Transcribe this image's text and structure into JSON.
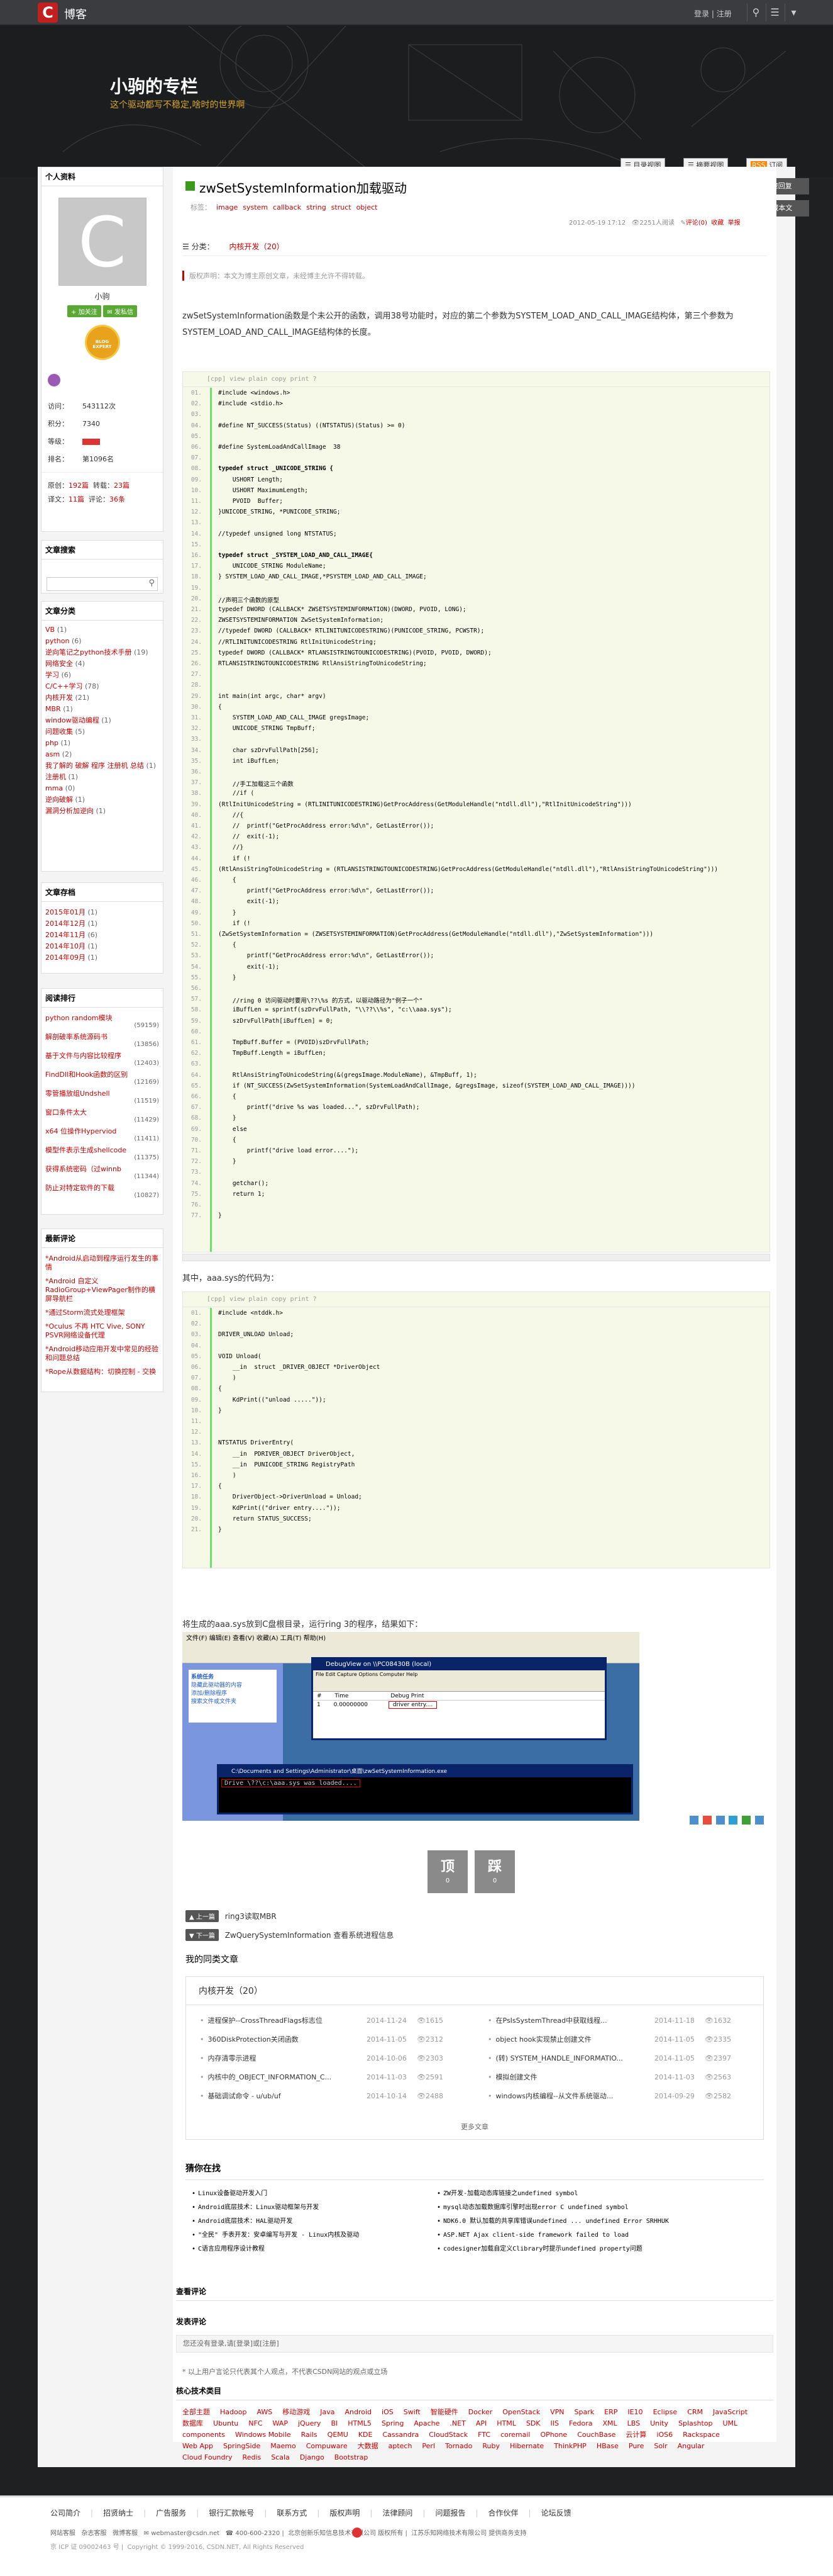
{
  "topbar": {
    "brand": "博客",
    "login": "登录",
    "sep": "|",
    "register": "注册"
  },
  "banner": {
    "title": "小驹的专栏",
    "subtitle": "这个驱动都写不稳定,啥时的世界啊",
    "btn_dir": "目录视图",
    "btn_summary": "摘要视图",
    "btn_rss": "订阅"
  },
  "right_tools": {
    "contact": "快速回复",
    "favorite": "收藏本文"
  },
  "profile": {
    "header": "个人资料",
    "name": "小驹",
    "follow": "+ 加关注",
    "message": "发私信",
    "visits_label": "访问：",
    "visits": "543112次",
    "points_label": "积分：",
    "points": "7340",
    "level_label": "等级：",
    "rank_label": "排名：",
    "rank": "第1096名",
    "orig_label": "原创：",
    "orig": "192篇",
    "repost_label": "转载：",
    "repost": "23篇",
    "trans_label": "译文：",
    "trans": "11篇",
    "comment_label": "评论：",
    "comment": "36条",
    "badge": "BLOG EXPERT"
  },
  "search": {
    "header": "文章搜索"
  },
  "categories": {
    "header": "文章分类",
    "items": [
      {
        "name": "VB",
        "count": "(1)"
      },
      {
        "name": "python",
        "count": "(6)"
      },
      {
        "name": "逆向笔记之python技术手册",
        "count": "(19)"
      },
      {
        "name": "网络安全",
        "count": "(4)"
      },
      {
        "name": "学习",
        "count": "(6)"
      },
      {
        "name": "C/C++学习",
        "count": "(78)"
      },
      {
        "name": "内核开发",
        "count": "(21)"
      },
      {
        "name": "MBR",
        "count": "(1)"
      },
      {
        "name": "window驱动编程",
        "count": "(1)"
      },
      {
        "name": "问题收集",
        "count": "(5)"
      },
      {
        "name": "php",
        "count": "(1)"
      },
      {
        "name": "asm",
        "count": "(2)"
      },
      {
        "name": "我了解的 破解 程序 注册机 总结",
        "count": "(1)"
      },
      {
        "name": "注册机",
        "count": "(1)"
      },
      {
        "name": "mma",
        "count": "(0)"
      },
      {
        "name": "逆向破解",
        "count": "(1)"
      },
      {
        "name": "漏洞分析加逆向",
        "count": "(1)"
      }
    ]
  },
  "archive": {
    "header": "文章存档",
    "items": [
      {
        "name": "2015年01月",
        "count": "(1)"
      },
      {
        "name": "2014年12月",
        "count": "(1)"
      },
      {
        "name": "2014年11月",
        "count": "(6)"
      },
      {
        "name": "2014年10月",
        "count": "(1)"
      },
      {
        "name": "2014年09月",
        "count": "(1)"
      }
    ]
  },
  "popular": {
    "header": "阅读排行",
    "items": [
      {
        "name": "python random模块",
        "count": "(59159)"
      },
      {
        "name": "解剖破率系统源码书",
        "count": "(13856)"
      },
      {
        "name": "基于文件与内容比较程序",
        "count": "(12403)"
      },
      {
        "name": "FindDll和Hook函数的区别",
        "count": "(12169)"
      },
      {
        "name": "零管播放组Undshell",
        "count": "(11519)"
      },
      {
        "name": "窗口条件太大",
        "count": "(11429)"
      },
      {
        "name": "x64 位操作Hyperviod",
        "count": "(11411)"
      },
      {
        "name": "模型件表示生成shellcode",
        "count": "(11375)"
      },
      {
        "name": "获得系统密码（过winnb",
        "count": "(11344)"
      },
      {
        "name": "防止对特定软件的下载",
        "count": "(10827)"
      }
    ]
  },
  "latest_comments": {
    "header": "最新评论",
    "items": [
      "*Android从启动到程序运行发生的事情",
      "*Android 自定义 RadioGroup+ViewPager制作的横屏导航栏",
      "*通过Storm流式处理框架",
      "*Oculus 不再 HTC Vive, SONY PSVR网络设备代理",
      "*Android移动应用开发中常见的经验和问题总结",
      "*Rope从数据结构：切换控制 - 交换"
    ]
  },
  "post": {
    "title": "zwSetSystemInformation加载驱动",
    "tags": [
      "标签：",
      "image",
      "system",
      "callback",
      "string",
      "struct",
      "object"
    ],
    "date": "2012-05-19 17:12",
    "views": "2251人阅读",
    "comments_link": "评论(0)",
    "favorite": "收藏",
    "report": "举报",
    "category_label": "分类：",
    "category": "内核开发（20）",
    "copyright": "版权声明：本文为博主原创文章，未经博主允许不得转载。",
    "intro": "zwSetSystemInformation函数是个未公开的函数，调用38号功能时，对应的第二个参数为SYSTEM_LOAD_AND_CALL_IMAGE结构体，第三个参数为SYSTEM_LOAD_AND_CALL_IMAGE结构体的长度。",
    "code_header": "[cpp] view plain   copy   print   ?",
    "second_text": "其中，aaa.sys的代码为：",
    "third_text": "将生成的aaa.sys放到C盘根目录，运行ring 3的程序，结果如下：",
    "prev_label": "上一篇",
    "prev": "ring3读取MBR",
    "next_label": "下一篇",
    "next": "ZwQuerySystemInformation 查看系统进程信息",
    "vote_up": "顶",
    "vote_up_count": "0",
    "vote_down": "踩",
    "vote_down_count": "0",
    "my_similar": "我的同类文章"
  },
  "similar": {
    "title": "内核开发（20）",
    "left": [
      {
        "t": "进程保护--CrossThreadFlags标志位",
        "d": "2014-11-24",
        "v": "1615"
      },
      {
        "t": "360DiskProtection关闭函数",
        "d": "2014-11-05",
        "v": "2312"
      },
      {
        "t": "内存清零示进程",
        "d": "2014-10-06",
        "v": "2303"
      },
      {
        "t": "内核中的_OBJECT_INFORMATION_C...",
        "d": "2014-11-03",
        "v": "2591"
      },
      {
        "t": "基础调试命令 - u/ub/uf",
        "d": "2014-10-14",
        "v": "2488"
      }
    ],
    "right": [
      {
        "t": "在PsIsSystemThread中获取线程...",
        "d": "2014-11-18",
        "v": "1632"
      },
      {
        "t": "object hook实现禁止创建文件",
        "d": "2014-11-05",
        "v": "2335"
      },
      {
        "t": "(转) SYSTEM_HANDLE_INFORMATIO...",
        "d": "2014-11-05",
        "v": "2397"
      },
      {
        "t": "模拟创建文件",
        "d": "2014-11-03",
        "v": "2563"
      },
      {
        "t": "windows内核编程--从文件系统驱动...",
        "d": "2014-09-29",
        "v": "2582"
      }
    ],
    "more": "更多文章"
  },
  "follow": {
    "title": "猜你在找",
    "left": [
      "Linux设备驱动开发入门",
      "Android底层技术：Linux驱动框架与开发",
      "Android底层技术：HAL驱动开发",
      "\"全民\" 手表开发：安卓编写与开发 - Linux内核及驱动",
      "C语言应用程序设计教程"
    ],
    "right": [
      "ZW开发-加载动态库链接之undefined symbol",
      "mysql动态加载数据库引擎时出现error C undefined symbol",
      "NDK6.0 默认加载的共享库错误undefined ... undefined Error SRHHUK",
      "ASP.NET Ajax client-side framework failed to load",
      "codesigner加载自定义Clibrary时提示undefined property问题"
    ]
  },
  "view_comments": "查看评论",
  "post_comment": {
    "header": "发表评论",
    "hint": "您还没有登录,请[登录]或[注册]",
    "notice": "* 以上用户言论只代表其个人观点，不代表CSDN网站的观点或立场"
  },
  "core_tech": {
    "header": "核心技术类目",
    "items": [
      "全部主题",
      "Hadoop",
      "AWS",
      "移动游戏",
      "Java",
      "Android",
      "iOS",
      "Swift",
      "智能硬件",
      "Docker",
      "OpenStack",
      "VPN",
      "Spark",
      "ERP",
      "IE10",
      "Eclipse",
      "CRM",
      "JavaScript",
      "数据库",
      "Ubuntu",
      "NFC",
      "WAP",
      "jQuery",
      "BI",
      "HTML5",
      "Spring",
      "Apache",
      ".NET",
      "API",
      "HTML",
      "SDK",
      "IIS",
      "Fedora",
      "XML",
      "LBS",
      "Unity",
      "Splashtop",
      "UML",
      "components",
      "Windows Mobile",
      "Rails",
      "QEMU",
      "KDE",
      "Cassandra",
      "CloudStack",
      "FTC",
      "coremail",
      "OPhone",
      "CouchBase",
      "云计算",
      "iOS6",
      "Rackspace",
      "Web App",
      "SpringSide",
      "Maemo",
      "Compuware",
      "大数据",
      "aptech",
      "Perl",
      "Tornado",
      "Ruby",
      "Hibernate",
      "ThinkPHP",
      "HBase",
      "Pure",
      "Solr",
      "Angular",
      "Cloud Foundry",
      "Redis",
      "Scala",
      "Django",
      "Bootstrap"
    ]
  },
  "footer": {
    "links": [
      "公司简介",
      "招贤纳士",
      "广告服务",
      "银行汇款帐号",
      "联系方式",
      "版权声明",
      "法律顾问",
      "问题报告",
      "合作伙伴",
      "论坛反馈"
    ],
    "service": "网站客服",
    "magazine": "杂志客服",
    "weibo": "微博客服",
    "email": "webmaster@csdn.net",
    "phone": "400-600-2320",
    "company": "北京创新乐知信息技术有限公司 版权所有",
    "company2": "江苏乐知网络技术有限公司 提供商务支持",
    "icp": "京 ICP 证 09002463 号",
    "copyright": "Copyright © 1999-2016, CSDN.NET, All Rights Reserved"
  },
  "screenshot": {
    "title": "DebugView on \\\\PC08430B (local)",
    "menu": "File Edit Capture Options Computer Help",
    "col_hash": "#",
    "col_time": "Time",
    "col_debug": "Debug Print",
    "row_num": "1",
    "row_time": "0.00000000",
    "row_msg": "driver entry....",
    "explorer_title": "系统任务",
    "explorer_item1": "隐藏此驱动器的内容",
    "explorer_item2": "添加/删除程序",
    "explorer_item3": "搜索文件或文件夹",
    "cmd_title": "C:\\Documents and Settings\\Administrator\\桌面\\zwSetSystemInformation.exe",
    "cmd_line": "Drive \\??\\c:\\aaa.sys was loaded...."
  }
}
